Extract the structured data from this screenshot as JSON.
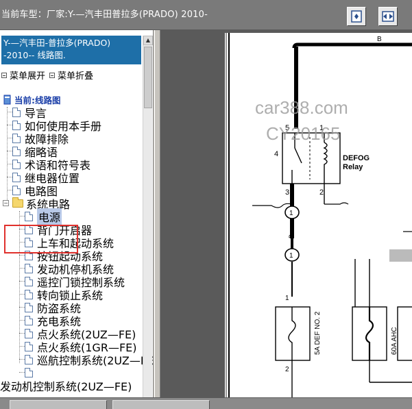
{
  "titlebar": {
    "title": "当前车型：厂家:Y-—汽丰田普拉多(PRADO) 2010-",
    "buttons": [
      "fit-page-icon",
      "fit-width-icon"
    ]
  },
  "sidebar": {
    "header": "Y-—汽丰田-普拉多(PRADO) -2010-- 线路图.",
    "expand_label": "菜单展开",
    "collapse_label": "菜单折叠",
    "current_label": "当前:线路图",
    "items": [
      {
        "label": "导言"
      },
      {
        "label": "如何使用本手册"
      },
      {
        "label": "故障排除"
      },
      {
        "label": "缩略语"
      },
      {
        "label": "术语和符号表"
      },
      {
        "label": "继电器位置"
      },
      {
        "label": "电路图"
      }
    ],
    "folder": {
      "label": "系统电路",
      "selected": "电源",
      "children": [
        {
          "label": "背门开启器"
        },
        {
          "label": "上车和起动系统"
        },
        {
          "label": "按钮起动系统"
        },
        {
          "label": "发动机停机系统"
        },
        {
          "label": "遥控门锁控制系统"
        },
        {
          "label": "转向锁止系统"
        },
        {
          "label": "防盗系统"
        },
        {
          "label": "充电系统"
        },
        {
          "label": "点火系统(2UZ—FE)"
        },
        {
          "label": "点火系统(1GR—FE)"
        },
        {
          "label": "巡航控制系统(2UZ—FE)"
        },
        {
          "label": ""
        }
      ]
    },
    "overflow_item": "发动机控制系统(2UZ—FE)"
  },
  "diagram": {
    "watermark_line1": "car388.com",
    "watermark_line2": "CY20165",
    "wire_b": "B",
    "relay_name": "DEFOG",
    "relay_sub": "Relay",
    "pin_5": "5",
    "pin_1": "1",
    "pin_4": "4",
    "pin_3": "3",
    "pin_2": "2",
    "conn_1": "1",
    "conn_2": "1",
    "fuse1_top": "1",
    "fuse1_bottom": "2",
    "fuse1_label": "5A DEF NO. 2",
    "fuse2_label": "60A AHC",
    "wire_b2": "B"
  }
}
